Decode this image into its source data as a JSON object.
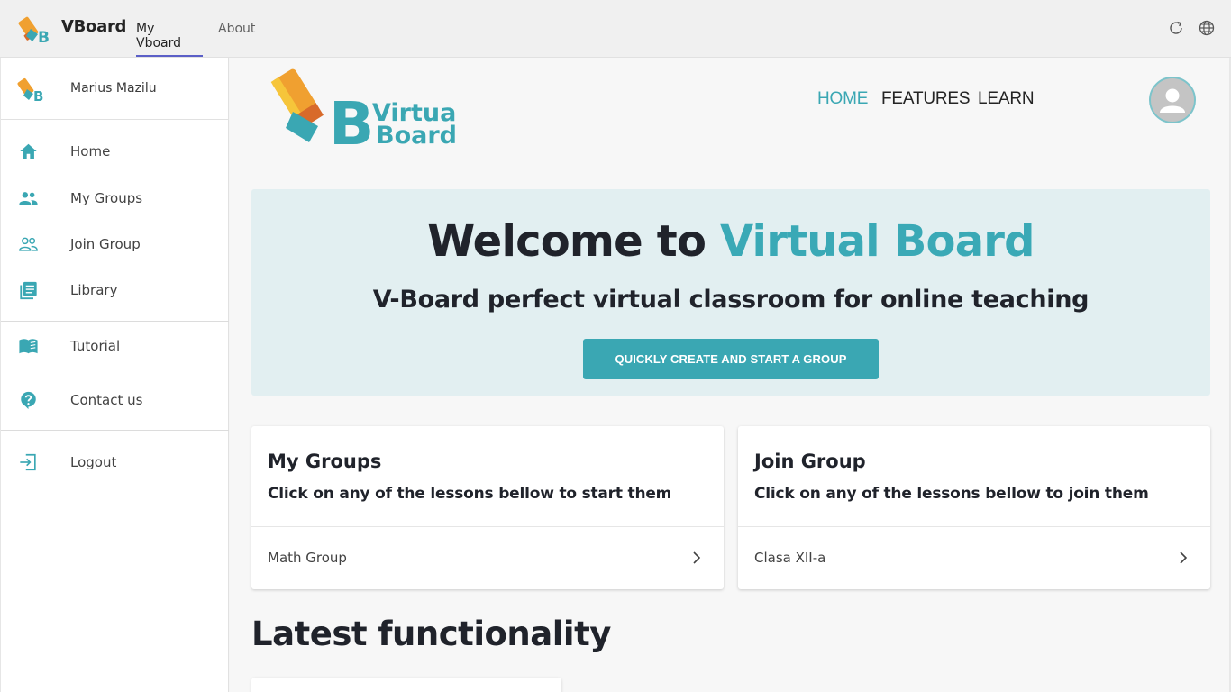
{
  "app": {
    "name": "VBoard",
    "tabs": [
      {
        "label": "My Vboard",
        "active": true
      },
      {
        "label": "About",
        "active": false
      }
    ],
    "toolbar_icons": [
      "refresh-icon",
      "globe-icon"
    ]
  },
  "sidebar": {
    "user_name": "Marius Mazilu",
    "items": [
      {
        "label": "Home",
        "icon": "home-icon"
      },
      {
        "label": "My Groups",
        "icon": "groups-icon"
      },
      {
        "label": "Join Group",
        "icon": "join-group-icon"
      },
      {
        "label": "Library",
        "icon": "library-icon"
      },
      {
        "label": "Tutorial",
        "icon": "book-icon"
      },
      {
        "label": "Contact us",
        "icon": "help-icon"
      },
      {
        "label": "Logout",
        "icon": "logout-icon"
      }
    ]
  },
  "brand": {
    "line1": "Virtual",
    "line2": "Board",
    "letter": "B"
  },
  "top_nav": [
    {
      "label": "HOME",
      "active": true
    },
    {
      "label": "FEATURES",
      "active": false
    },
    {
      "label": "LEARN",
      "active": false
    }
  ],
  "hero": {
    "title_prefix": "Welcome to ",
    "title_accent": "Virtual Board",
    "subtitle": "V-Board perfect virtual classroom for online teaching",
    "button_label": "QUICKLY CREATE AND START A GROUP"
  },
  "cards": [
    {
      "title": "My Groups",
      "description": "Click on any of the lessons bellow to start them",
      "rows": [
        "Math Group"
      ]
    },
    {
      "title": "Join Group",
      "description": "Click on any of the lessons bellow to join them",
      "rows": [
        "Clasa XII-a"
      ]
    }
  ],
  "section_title": "Latest functionality",
  "colors": {
    "accent": "#3aa7b3",
    "hero_bg": "#e2eff1",
    "tab_underline": "#5b5fc7",
    "logo_orange": "#f0a030",
    "logo_teal": "#3aa7b3"
  }
}
